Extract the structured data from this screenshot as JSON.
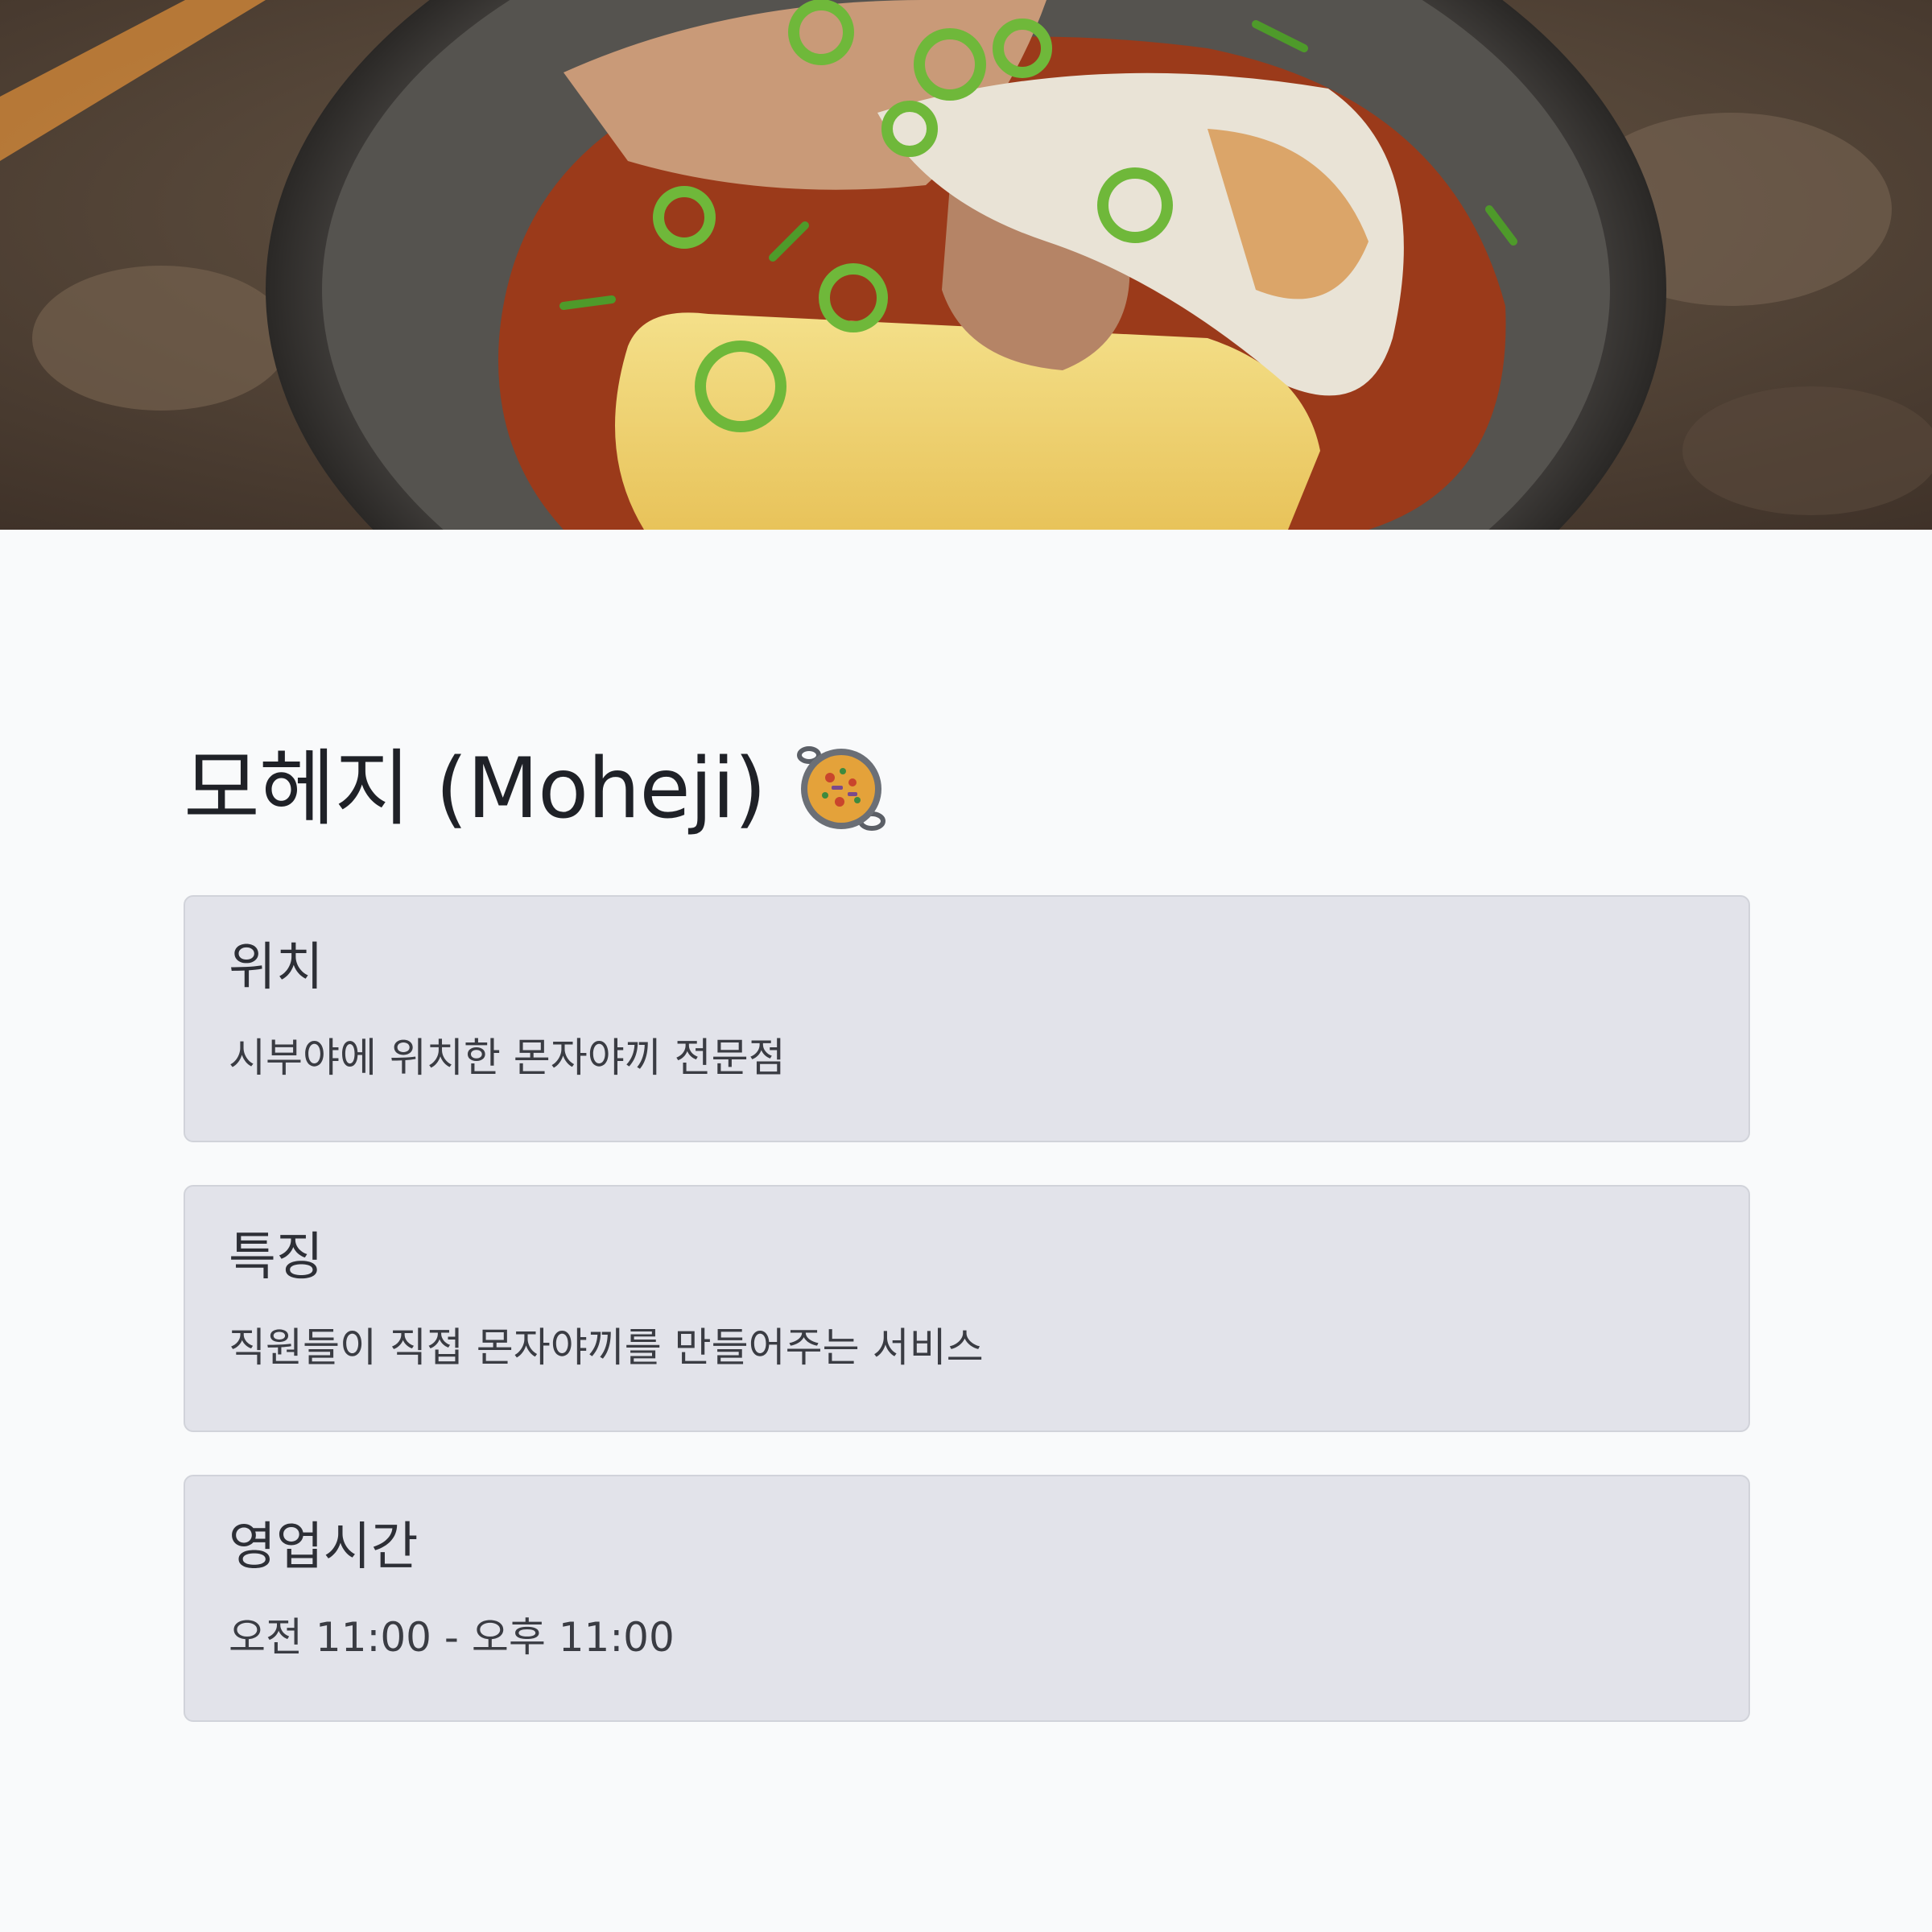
{
  "hero": {
    "image_name": "okonomiyaki-photo"
  },
  "restaurant": {
    "title": "모헤지 (Moheji)",
    "emoji_icon": "paella-pan-icon"
  },
  "cards": [
    {
      "heading": "위치",
      "body": "시부야에 위치한 몬자야끼 전문점"
    },
    {
      "heading": "특징",
      "body": "직원들이 직접 몬자야끼를 만들어주는 서비스"
    },
    {
      "heading": "영업시간",
      "body": "오전 11:00 - 오후 11:00"
    }
  ],
  "colors": {
    "page_background": "#f9fafb",
    "card_background": "#e2e3ea",
    "card_border": "#d1d3da",
    "title_text": "#1f2127"
  }
}
